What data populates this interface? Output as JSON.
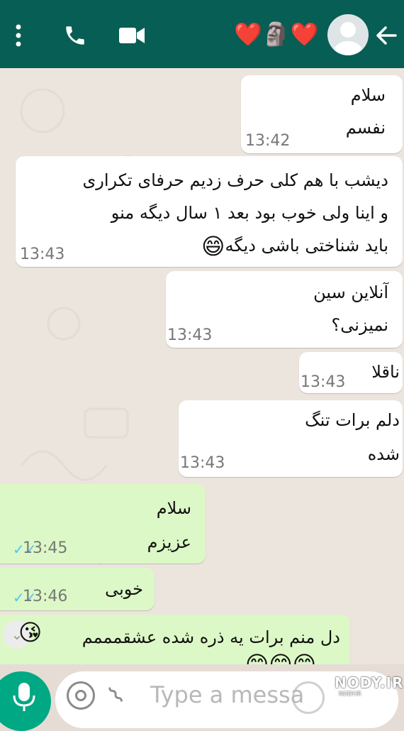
{
  "header": {
    "contact_name_emoji": "❤️🗿❤️",
    "icons": [
      "back-arrow-icon",
      "avatar",
      "video-call-icon",
      "phone-icon",
      "more-vert-icon"
    ],
    "bg_color": "#075e54"
  },
  "messages": [
    {
      "dir": "in",
      "lines": [
        "سلام",
        "نفسم"
      ],
      "time": "13:42"
    },
    {
      "dir": "in",
      "lines": [
        "دیشب با هم کلی حرف زدیم حرفای تکراری",
        "و اینا ولی خوب بود بعد ۱ سال دیگه منو",
        "باید شناختی باشی دیگه"
      ],
      "time": "13:43",
      "emoji": "😄"
    },
    {
      "dir": "in",
      "lines": [
        "آنلاین سین",
        "نمیزنی؟"
      ],
      "time": "13:43"
    },
    {
      "dir": "in",
      "lines": [
        "ناقلا"
      ],
      "time": "13:43"
    },
    {
      "dir": "in",
      "lines": [
        "دلم برات تنگ",
        "شده"
      ],
      "time": "13:43"
    },
    {
      "dir": "out",
      "lines": [
        "سلام",
        "عزیزم"
      ],
      "time": "13:45",
      "status": "read"
    },
    {
      "dir": "out",
      "lines": [
        "خوبی"
      ],
      "time": "13:46",
      "status": "read"
    },
    {
      "dir": "out",
      "lines": [
        "دل منم برات یه ذره شده عشقمممم"
      ],
      "emoji_end": "😘",
      "emoji_row": "😊😊😊"
    }
  ],
  "composer": {
    "placeholder": "Type a messa",
    "icons": [
      "mic-icon",
      "camera-icon",
      "attach-icon",
      "emoji-icon"
    ]
  },
  "watermark": {
    "text": "NODY.IR",
    "sub": "NODY.IR"
  },
  "colors": {
    "incoming": "#ffffff",
    "outgoing": "#dcf8c6",
    "accent": "#00a884",
    "read_tick": "#4fc3f7"
  }
}
